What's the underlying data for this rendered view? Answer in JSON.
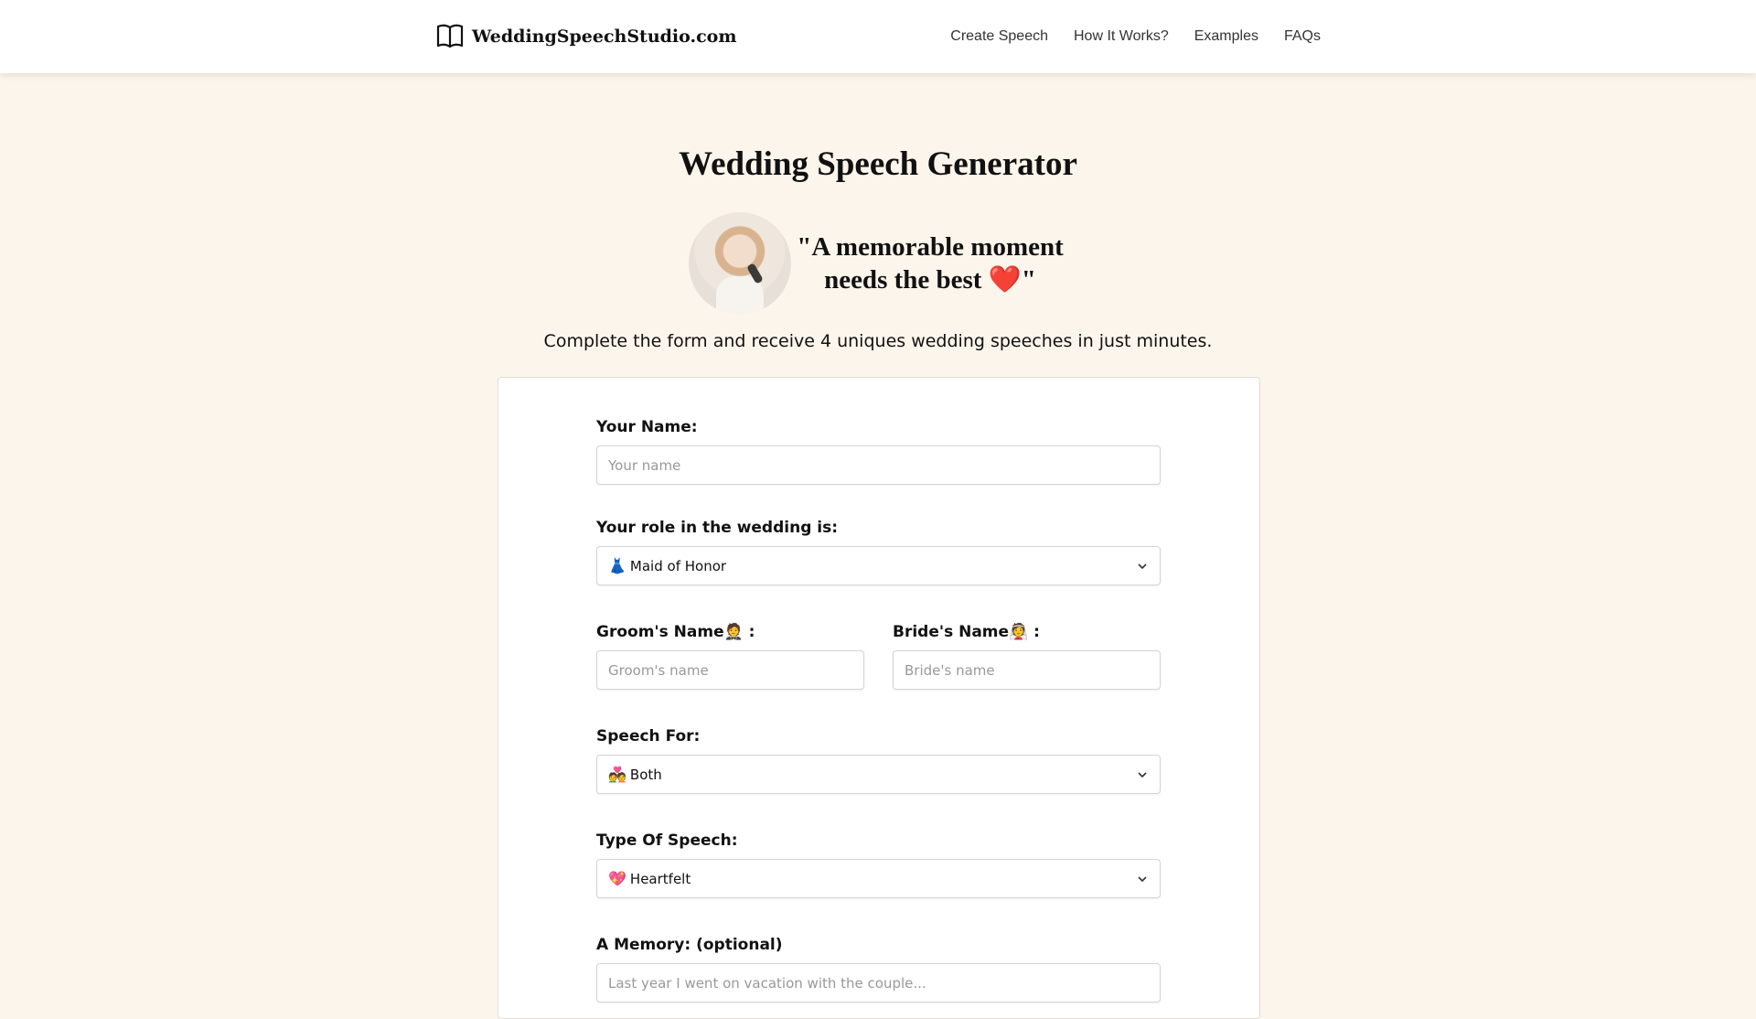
{
  "brand": {
    "name": "WeddingSpeechStudio.com",
    "icon": "open-book-icon"
  },
  "nav": {
    "items": [
      "Create Speech",
      "How It Works?",
      "Examples",
      "FAQs"
    ]
  },
  "hero": {
    "title": "Wedding Speech Generator",
    "quote_line1": "\"A memorable moment",
    "quote_line2": "needs the best ❤️\"",
    "subtitle": "Complete the form and receive 4 uniques wedding speeches in just minutes."
  },
  "form": {
    "your_name": {
      "label": "Your Name:",
      "placeholder": "Your name"
    },
    "role": {
      "label": "Your role in the wedding is:",
      "emoji": "👗",
      "value": "Maid of Honor"
    },
    "groom": {
      "label": "Groom's Name🤵 :",
      "placeholder": "Groom's name"
    },
    "bride": {
      "label": "Bride's Name👰 :",
      "placeholder": "Bride's name"
    },
    "speech_for": {
      "label": "Speech For:",
      "emoji": "💑",
      "value": "Both"
    },
    "speech_type": {
      "label": "Type Of Speech:",
      "emoji": "💖",
      "value": "Heartfelt"
    },
    "memory": {
      "label": "A Memory: (optional)",
      "placeholder": "Last year I went on vacation with the couple..."
    }
  }
}
